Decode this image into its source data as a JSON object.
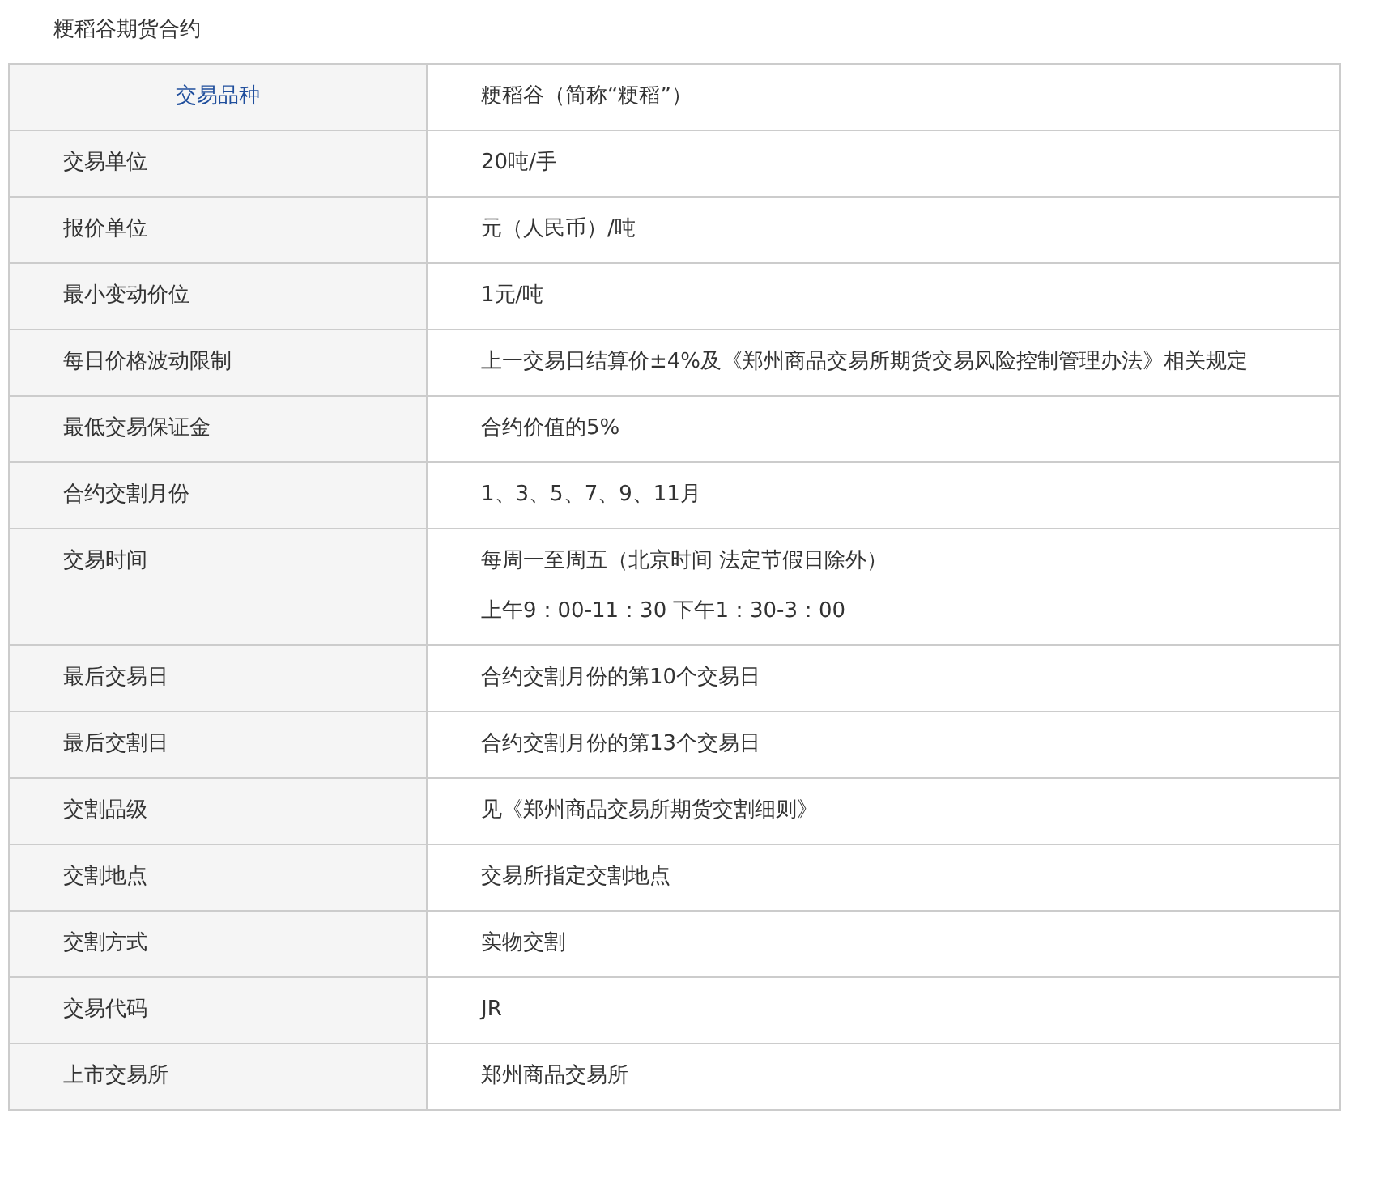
{
  "title": "粳稻谷期货合约",
  "table": {
    "rows": [
      {
        "kind": "header",
        "label": "交易品种",
        "values": [
          "粳稻谷（简称“粳稻”）"
        ]
      },
      {
        "kind": "normal",
        "label": "交易单位",
        "values": [
          "20吨/手"
        ]
      },
      {
        "kind": "normal",
        "label": "报价单位",
        "values": [
          "元（人民币）/吨"
        ]
      },
      {
        "kind": "normal",
        "label": "最小变动价位",
        "values": [
          "1元/吨"
        ]
      },
      {
        "kind": "normal",
        "label": "每日价格波动限制",
        "values": [
          "上一交易日结算价±4%及《郑州商品交易所期货交易风险控制管理办法》相关规定"
        ]
      },
      {
        "kind": "normal",
        "label": "最低交易保证金",
        "values": [
          "合约价值的5%"
        ]
      },
      {
        "kind": "normal",
        "label": "合约交割月份",
        "values": [
          "1、3、5、7、9、11月"
        ]
      },
      {
        "kind": "normal",
        "label": "交易时间",
        "values": [
          "每周一至周五（北京时间 法定节假日除外）",
          "上午9：00-11：30 下午1：30-3：00"
        ]
      },
      {
        "kind": "normal",
        "label": "最后交易日",
        "values": [
          "合约交割月份的第10个交易日"
        ]
      },
      {
        "kind": "normal",
        "label": "最后交割日",
        "values": [
          "合约交割月份的第13个交易日"
        ]
      },
      {
        "kind": "normal",
        "label": "交割品级",
        "values": [
          "见《郑州商品交易所期货交割细则》"
        ]
      },
      {
        "kind": "normal",
        "label": "交割地点",
        "values": [
          "交易所指定交割地点"
        ]
      },
      {
        "kind": "normal",
        "label": "交割方式",
        "values": [
          "实物交割"
        ]
      },
      {
        "kind": "normal",
        "label": "交易代码",
        "values": [
          "JR"
        ]
      },
      {
        "kind": "normal",
        "label": "上市交易所",
        "values": [
          "郑州商品交易所"
        ]
      }
    ]
  }
}
